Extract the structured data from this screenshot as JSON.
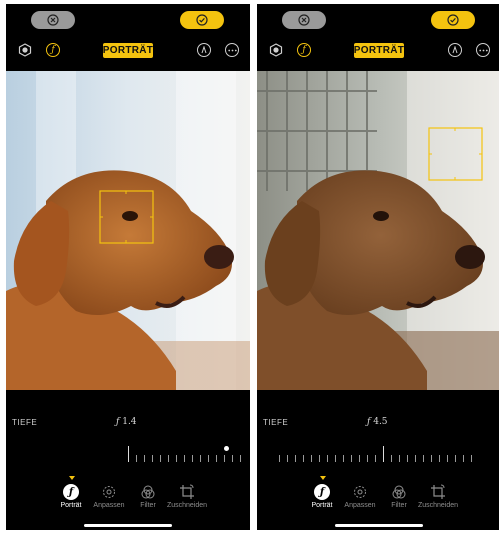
{
  "screens": [
    {
      "id": "left",
      "mode_label": "PORTRÄT",
      "depth_label": "TIEFE",
      "depth_value": "1.4",
      "depth_symbol": "ƒ",
      "f_glyph": "ƒ",
      "tabs": [
        {
          "label": "Porträt",
          "icon": "aperture-f-icon",
          "active": true
        },
        {
          "label": "Anpassen",
          "icon": "adjust-dial-icon",
          "active": false
        },
        {
          "label": "Filter",
          "icon": "filter-circles-icon",
          "active": false
        },
        {
          "label": "Zuschneiden",
          "icon": "crop-rotate-icon",
          "active": false
        }
      ]
    },
    {
      "id": "right",
      "mode_label": "PORTRÄT",
      "depth_label": "TIEFE",
      "depth_value": "4.5",
      "depth_symbol": "ƒ",
      "f_glyph": "ƒ",
      "tabs": [
        {
          "label": "Porträt",
          "icon": "aperture-f-icon",
          "active": true
        },
        {
          "label": "Anpassen",
          "icon": "adjust-dial-icon",
          "active": false
        },
        {
          "label": "Filter",
          "icon": "filter-circles-icon",
          "active": false
        },
        {
          "label": "Zuschneiden",
          "icon": "crop-rotate-icon",
          "active": false
        }
      ]
    }
  ],
  "colors": {
    "accent": "#f4c30f",
    "background": "#000000",
    "inactive_text": "#8e8e8e"
  },
  "icons": [
    "cancel-x-icon",
    "done-check-icon",
    "portrait-lighting-icon",
    "depth-f-icon",
    "markup-pen-icon",
    "more-ellipsis-icon"
  ]
}
